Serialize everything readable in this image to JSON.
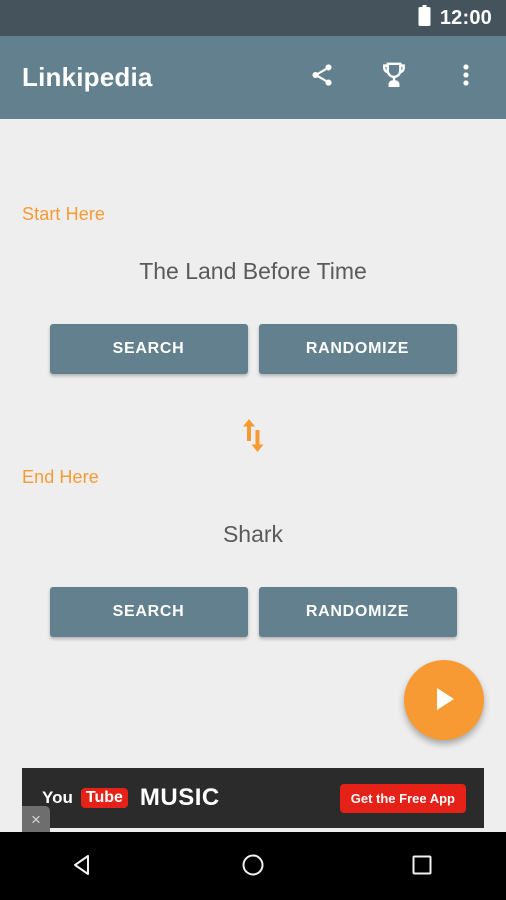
{
  "status_bar": {
    "clock": "12:00",
    "battery_icon": "battery-full-icon",
    "background": "#44535c"
  },
  "app_bar": {
    "title": "Linkipedia",
    "background": "#62808d",
    "icons": [
      {
        "name": "share-icon",
        "label": "Share"
      },
      {
        "name": "trophy-icon",
        "label": "Achievements"
      },
      {
        "name": "overflow-menu-icon",
        "label": "More options"
      }
    ]
  },
  "content": {
    "background": "#eeeeee",
    "accent_color": "#f89a33",
    "start_section": {
      "label": "Start Here",
      "term": "The Land Before Time",
      "search_label": "SEARCH",
      "randomize_label": "RANDOMIZE"
    },
    "swap": {
      "icon": "swap-vertical-icon",
      "label": "Swap start and end"
    },
    "end_section": {
      "label": "End Here",
      "term": "Shark",
      "search_label": "SEARCH",
      "randomize_label": "RANDOMIZE"
    },
    "fab": {
      "icon": "play-icon",
      "label": "Start",
      "color": "#f89a33"
    }
  },
  "ad": {
    "brand_you": "You",
    "brand_tube": "Tube",
    "brand_music": "MUSIC",
    "cta_label": "Get the Free App",
    "close_label": "×",
    "background": "#2b2b2b",
    "cta_color": "#e62117"
  },
  "nav_bar": {
    "background": "#000000",
    "buttons": [
      {
        "name": "nav-back-button",
        "icon": "back-triangle-icon"
      },
      {
        "name": "nav-home-button",
        "icon": "home-circle-icon"
      },
      {
        "name": "nav-recents-button",
        "icon": "recents-square-icon"
      }
    ]
  }
}
